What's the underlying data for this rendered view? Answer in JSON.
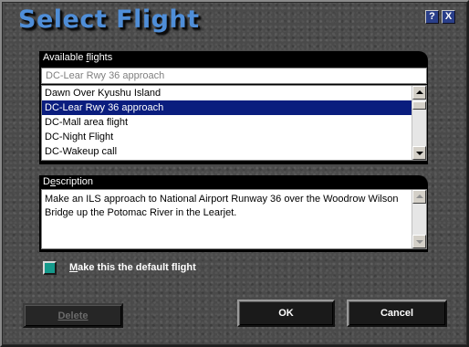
{
  "window": {
    "title": "Select Flight",
    "help_label": "?",
    "close_label": "X"
  },
  "available_flights": {
    "label_pre": "Available ",
    "label_accel": "f",
    "label_post": "lights",
    "selected_value": "DC-Lear Rwy 36 approach",
    "items": [
      "Dawn Over Kyushu Island",
      "DC-Lear Rwy 36 approach",
      "DC-Mall area flight",
      "DC-Night Flight",
      "DC-Wakeup call"
    ],
    "selected_index": 1
  },
  "description": {
    "label_pre": "D",
    "label_accel": "e",
    "label_post": "scription",
    "text": "Make an ILS approach to National Airport Runway 36 over the Woodrow Wilson Bridge up the Potomac River in the Learjet."
  },
  "default_flight": {
    "label_accel": "M",
    "label_rest": "ake this the default flight"
  },
  "buttons": {
    "delete": "Delete",
    "ok": "OK",
    "cancel": "Cancel"
  },
  "colors": {
    "title": "#4f8ed8",
    "selection": "#0a1d7e",
    "checkbox": "#159a8c"
  }
}
